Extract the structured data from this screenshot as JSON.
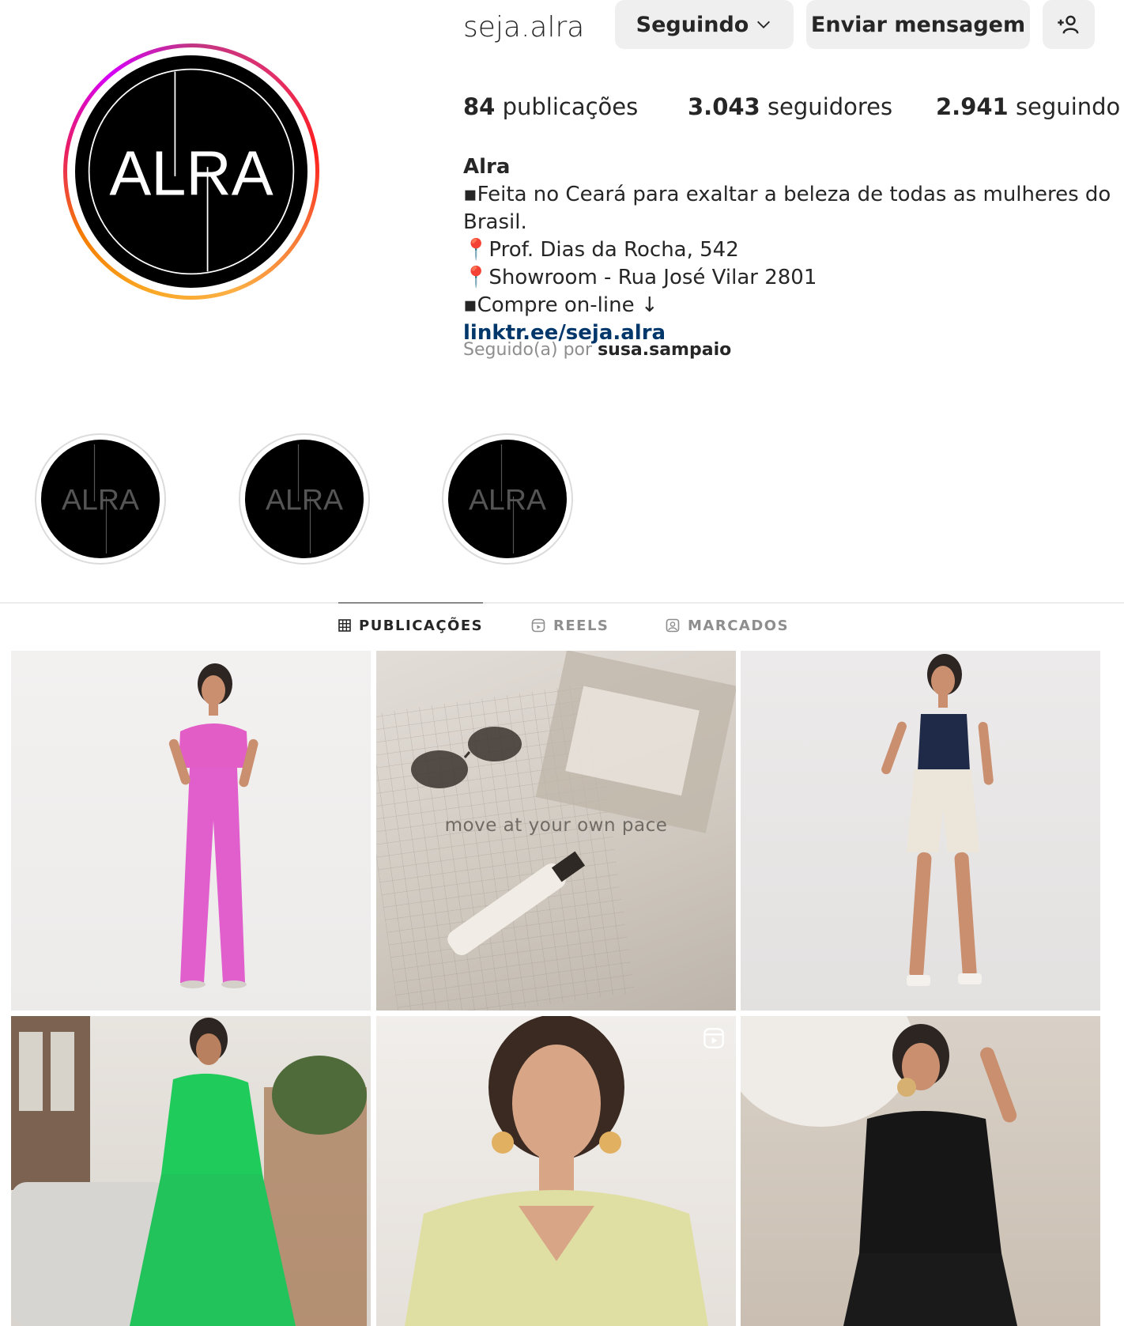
{
  "profile": {
    "username": "seja.alra",
    "logo_text": "ALRA",
    "buttons": {
      "following_label": "Seguindo",
      "message_label": "Enviar mensagem"
    },
    "stats": {
      "posts_count": "84",
      "posts_label": "publicações",
      "followers_count": "3.043",
      "followers_label": "seguidores",
      "following_count": "2.941",
      "following_label": "seguindo"
    },
    "bio": {
      "name": "Alra",
      "lines": [
        "▪Feita no Ceará para exaltar a beleza de todas as mulheres do Brasil.",
        "📍Prof. Dias da Rocha, 542",
        "📍Showroom - Rua José Vilar 2801",
        "▪Compre on-line ↓"
      ],
      "link": "linktr.ee/seja.alra"
    },
    "followed_by": {
      "prefix": "Seguido(a) por",
      "user": "susa.sampaio"
    }
  },
  "highlights": [
    {
      "logo_text": "ALRA"
    },
    {
      "logo_text": "ALRA"
    },
    {
      "logo_text": "ALRA"
    }
  ],
  "tabs": [
    {
      "label": "PUBLICAÇÕES",
      "icon": "grid-icon",
      "active": true
    },
    {
      "label": "REELS",
      "icon": "reels-icon",
      "active": false
    },
    {
      "label": "MARCADOS",
      "icon": "tagged-icon",
      "active": false
    }
  ],
  "posts": [
    {
      "kind": "photo",
      "caption": ""
    },
    {
      "kind": "photo",
      "caption": "move at your own pace"
    },
    {
      "kind": "photo",
      "caption": ""
    },
    {
      "kind": "photo",
      "caption": ""
    },
    {
      "kind": "reel",
      "caption": ""
    },
    {
      "kind": "photo",
      "caption": ""
    }
  ],
  "colors": {
    "text": "#262626",
    "muted": "#8e8e8e",
    "link": "#00376b",
    "button_bg": "#efefef",
    "divider": "#dbdbdb"
  }
}
